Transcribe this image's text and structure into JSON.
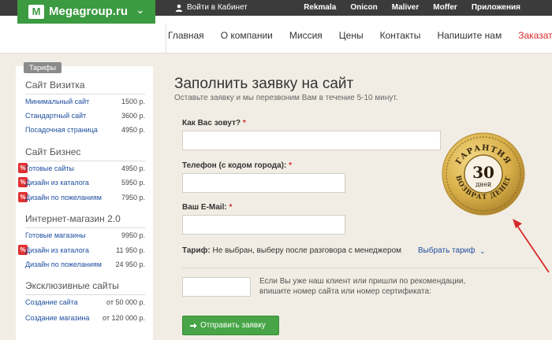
{
  "topbar": {
    "logo_mark": "M",
    "logo_text": "Megagroup.ru",
    "cabinet_label": "Войти в Кабинет",
    "links": [
      "Rekmala",
      "Onicon",
      "Maliver",
      "Moffer",
      "Приложения"
    ]
  },
  "nav": {
    "items": [
      "Главная",
      "О компании",
      "Миссия",
      "Цены",
      "Контакты",
      "Напишите нам"
    ],
    "order_label": "Заказать сайт"
  },
  "sidebar": {
    "tab_label": "Тарифы",
    "categories": [
      {
        "title": "Сайт Визитка",
        "items": [
          {
            "name": "Минимальный сайт",
            "price": "1500 р.",
            "discount": false
          },
          {
            "name": "Стандартный сайт",
            "price": "3600 р.",
            "discount": false
          },
          {
            "name": "Посадочная страница",
            "price": "4950 р.",
            "discount": false
          }
        ]
      },
      {
        "title": "Сайт Бизнес",
        "items": [
          {
            "name": "Готовые сайты",
            "price": "4950 р.",
            "discount": true
          },
          {
            "name": "Дизайн из каталога",
            "price": "5950 р.",
            "discount": true
          },
          {
            "name": "Дизайн по пожеланиям",
            "price": "7950 р.",
            "discount": true
          }
        ]
      },
      {
        "title": "Интернет-магазин 2.0",
        "items": [
          {
            "name": "Готовые магазины",
            "price": "9950 р.",
            "discount": false
          },
          {
            "name": "Дизайн из каталога",
            "price": "11 950 р.",
            "discount": true
          },
          {
            "name": "Дизайн по пожеланиям",
            "price": "24 950 р.",
            "discount": false
          }
        ]
      },
      {
        "title": "Эксклюзивные сайты",
        "items": [
          {
            "name": "Создание сайта",
            "price": "от 50 000 р.",
            "discount": false
          },
          {
            "name": "Создание магазина",
            "price": "от 120 000 р.",
            "discount": false
          }
        ]
      }
    ],
    "discount_symbol": "%"
  },
  "form": {
    "title": "Заполнить заявку на сайт",
    "subtitle": "Оставьте заявку и мы перезвоним Вам в течение 5-10 минут.",
    "name_label": "Как Вас зовут?",
    "phone_label": "Телефон (с кодом города):",
    "email_label": "Ваш E-Mail:",
    "required_mark": "*",
    "name_value": "",
    "phone_value": "",
    "email_value": "",
    "tariff_label": "Тариф:",
    "tariff_value": "Не выбран, выберу после разговора с менеджером",
    "choose_tariff": "Выбрать тариф",
    "cert_value": "",
    "cert_note": "Если Вы уже наш клиент или пришли по рекомендации, впишите номер сайта или номер сертификата:",
    "submit_label": "Отправить заявку"
  },
  "seal": {
    "top_text": "ГАРАНТИЯ",
    "number": "30",
    "unit": "дней",
    "bottom_text": "ВОЗВРАТ ДЕНЕГ"
  },
  "colors": {
    "brand_green": "#3c9a40",
    "topbar": "#3b3b3b",
    "link_blue": "#1f4fa0",
    "accent_red": "#d62a2a",
    "seal_gold": "#d9b04a"
  }
}
